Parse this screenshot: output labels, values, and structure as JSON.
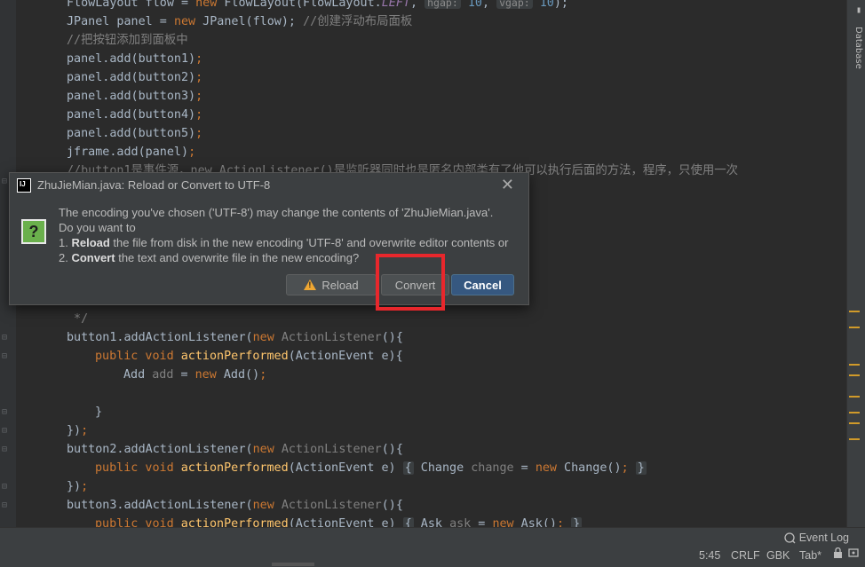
{
  "editor": {
    "lines": [
      {
        "segments": [
          [
            "FlowLayout flow = ",
            ""
          ],
          [
            "new",
            "kw"
          ],
          [
            " FlowLayout(FlowLayout.",
            ""
          ],
          [
            "LEFT",
            "ital"
          ],
          [
            ", ",
            ""
          ],
          [
            "hgap:",
            "hint"
          ],
          [
            " ",
            ""
          ],
          [
            "10",
            "num"
          ],
          [
            ", ",
            ""
          ],
          [
            "vgap:",
            "hint"
          ],
          [
            " ",
            ""
          ],
          [
            "10",
            "num"
          ],
          [
            ");",
            ""
          ]
        ]
      },
      {
        "segments": [
          [
            "JPanel panel = ",
            ""
          ],
          [
            "new",
            "kw"
          ],
          [
            " JPanel(flow); ",
            ""
          ],
          [
            "//创建浮动布局面板",
            "cm"
          ]
        ]
      },
      {
        "segments": [
          [
            "//把按钮添加到面板中",
            "cm"
          ]
        ]
      },
      {
        "segments": [
          [
            "panel.add(button1)",
            ""
          ],
          [
            ";",
            "kw"
          ]
        ]
      },
      {
        "segments": [
          [
            "panel.add(button2)",
            ""
          ],
          [
            ";",
            "kw"
          ]
        ]
      },
      {
        "segments": [
          [
            "panel.add(button3)",
            ""
          ],
          [
            ";",
            "kw"
          ]
        ]
      },
      {
        "segments": [
          [
            "panel.add(button4)",
            ""
          ],
          [
            ";",
            "kw"
          ]
        ]
      },
      {
        "segments": [
          [
            "panel.add(button5)",
            ""
          ],
          [
            ";",
            "kw"
          ]
        ]
      },
      {
        "segments": [
          [
            "jframe.add(panel)",
            ""
          ],
          [
            ";",
            "kw"
          ]
        ]
      },
      {
        "segments": [
          [
            "//button1是事件源，new ActionListener()是监听器同时也是匿名内部类有了他可以执行后面的方法，程序，只使用一次",
            "cm"
          ]
        ]
      }
    ],
    "lower_lines": [
      {
        "segments": [
          [
            " */",
            "cm"
          ]
        ]
      },
      {
        "segments": [
          [
            "button1.addActionListener(",
            ""
          ],
          [
            "new",
            "kw"
          ],
          [
            " ActionListener",
            "cm"
          ],
          [
            "(){",
            ""
          ]
        ]
      },
      {
        "segments": [
          [
            "public void ",
            "kw"
          ],
          [
            "actionPerformed",
            "fn"
          ],
          [
            "(ActionEvent e){",
            ""
          ]
        ]
      },
      {
        "segments": [
          [
            "Add ",
            ""
          ],
          [
            "add",
            "cm"
          ],
          [
            " = ",
            ""
          ],
          [
            "new",
            "kw"
          ],
          [
            " Add()",
            ""
          ],
          [
            ";",
            "kw"
          ]
        ]
      },
      {
        "segments": [
          [
            "",
            ""
          ]
        ]
      },
      {
        "segments": [
          [
            "}",
            ""
          ]
        ]
      },
      {
        "segments": [
          [
            "})",
            ""
          ],
          [
            ";",
            "kw"
          ]
        ]
      },
      {
        "segments": [
          [
            "button2.addActionListener(",
            ""
          ],
          [
            "new",
            "kw"
          ],
          [
            " ActionListener",
            "cm"
          ],
          [
            "(){",
            ""
          ]
        ]
      },
      {
        "segments": [
          [
            "public void ",
            "kw"
          ],
          [
            "actionPerformed",
            "fn"
          ],
          [
            "(ActionEvent e) ",
            ""
          ],
          [
            "{",
            "fold-box"
          ],
          [
            " Change ",
            ""
          ],
          [
            "change",
            "cm"
          ],
          [
            " = ",
            ""
          ],
          [
            "new",
            "kw"
          ],
          [
            " Change()",
            ""
          ],
          [
            ";",
            "kw"
          ],
          [
            " ",
            ""
          ],
          [
            "}",
            "fold-box"
          ]
        ]
      },
      {
        "segments": [
          [
            "})",
            ""
          ],
          [
            ";",
            "kw"
          ]
        ]
      },
      {
        "segments": [
          [
            "button3.addActionListener(",
            ""
          ],
          [
            "new",
            "kw"
          ],
          [
            " ActionListener",
            "cm"
          ],
          [
            "(){",
            ""
          ]
        ]
      },
      {
        "segments": [
          [
            "public void ",
            "kw"
          ],
          [
            "actionPerformed",
            "fn"
          ],
          [
            "(ActionEvent e) ",
            ""
          ],
          [
            "{",
            "fold-box"
          ],
          [
            " Ask ",
            ""
          ],
          [
            "ask",
            "cm"
          ],
          [
            " = ",
            ""
          ],
          [
            "new",
            "kw"
          ],
          [
            " Ask()",
            ""
          ],
          [
            ";",
            "kw"
          ],
          [
            " ",
            ""
          ],
          [
            "}",
            "fold-box"
          ]
        ]
      }
    ]
  },
  "side_panel": {
    "label": "Database"
  },
  "dialog": {
    "title": "ZhuJieMian.java: Reload or Convert to UTF-8",
    "line1": "The encoding you've chosen ('UTF-8') may change the contents of 'ZhuJieMian.java'.",
    "line2": "Do you want to",
    "line3_prefix": "1. ",
    "line3_bold": "Reload",
    "line3_rest": " the file from disk in the new encoding 'UTF-8' and overwrite editor contents or",
    "line4_prefix": "2. ",
    "line4_bold": "Convert",
    "line4_rest": " the text and overwrite file in the new encoding?",
    "reload_label": "Reload",
    "convert_label": "Convert",
    "cancel_label": "Cancel",
    "question_icon": "?"
  },
  "status_bar": {
    "event_log": "Event Log",
    "position": "5:45",
    "line_sep": "CRLF",
    "encoding": "GBK",
    "indent": "Tab*"
  },
  "colors": {
    "accent": "#365880",
    "highlight": "#e8272c",
    "warning": "#f0a732"
  }
}
